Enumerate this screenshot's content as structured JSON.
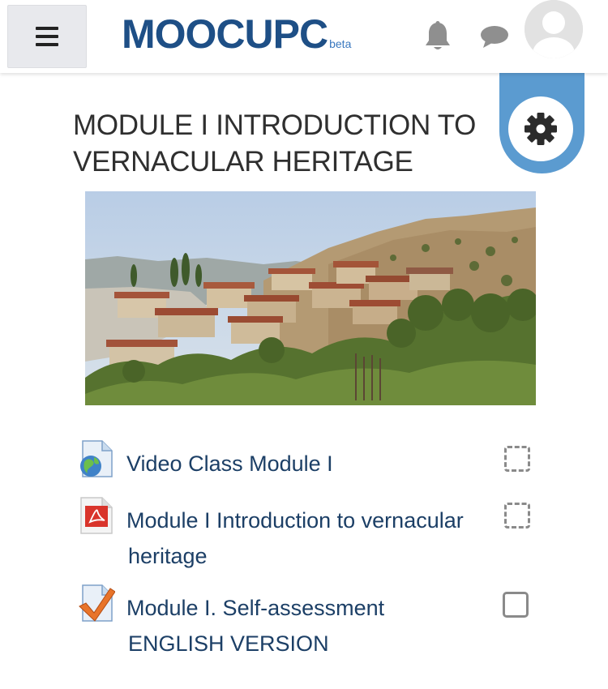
{
  "header": {
    "logo_text": "MOOCUPC",
    "logo_beta": "beta",
    "menu_icon": "hamburger-icon",
    "notification_icon": "bell-icon",
    "messages_icon": "chat-bubble-icon",
    "avatar_icon": "user-avatar-icon"
  },
  "settings": {
    "icon": "gear-icon",
    "accent_color": "#5b9bd0"
  },
  "page": {
    "title": "MODULE I INTRODUCTION TO VERNACULAR HERITAGE"
  },
  "activities": [
    {
      "label": "Video Class Module I",
      "label_line2": "",
      "icon": "url-globe-icon",
      "completion": "manual-dashed"
    },
    {
      "label": "Module I Introduction to vernacular",
      "label_line2": "heritage",
      "icon": "pdf-file-icon",
      "completion": "manual-dashed"
    },
    {
      "label": "Module I. Self-assessment",
      "label_line2": "ENGLISH VERSION",
      "icon": "quiz-checkmark-icon",
      "completion": "manual-solid"
    }
  ],
  "colors": {
    "link": "#1c3f66",
    "logo": "#1e4f86"
  }
}
